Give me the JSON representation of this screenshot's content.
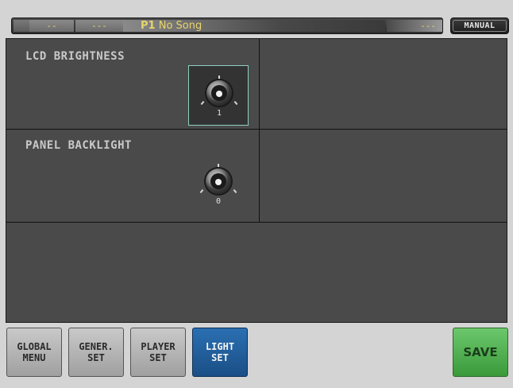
{
  "topbar": {
    "seg_a": "--",
    "seg_b": "---",
    "song_prefix": "P1",
    "song_name": "No Song",
    "seg_c": "---",
    "mode": "MANUAL"
  },
  "panel": {
    "lcd": {
      "title": "LCD BRIGHTNESS",
      "value": "1"
    },
    "backlight": {
      "title": "PANEL BACKLIGHT",
      "value": "0"
    }
  },
  "tabs": [
    {
      "label": "GLOBAL\nMENU"
    },
    {
      "label": "GENER.\nSET"
    },
    {
      "label": "PLAYER\nSET"
    },
    {
      "label": "LIGHT\nSET"
    }
  ],
  "save_label": "SAVE",
  "colors": {
    "accent_yellow": "#e8d56a",
    "active_tab": "#2b6fb2",
    "save_green": "#4fb34f",
    "selected_frame": "#8fd0c0"
  }
}
